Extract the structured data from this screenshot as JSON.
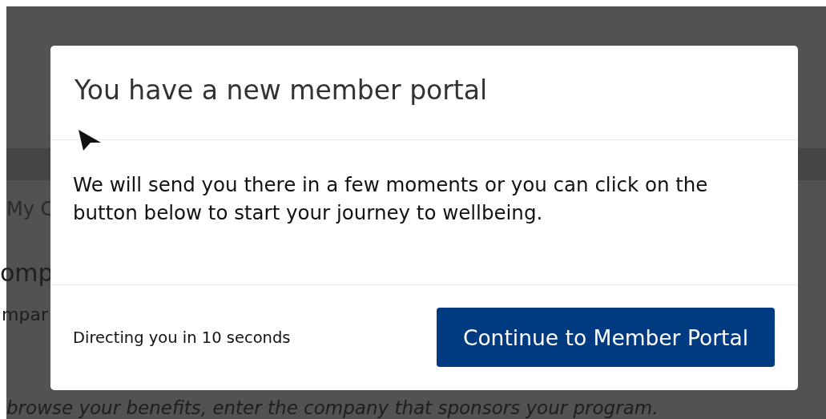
{
  "background": {
    "breadcrumb": "My C",
    "heading": "omp",
    "subheading": "mpar",
    "instruction": "browse your benefits, enter the company that sponsors your program."
  },
  "dialog": {
    "title": "You have a new member portal",
    "message": "We will send you there in a few moments or you can click on the button below to start your journey to wellbeing.",
    "countdown": "Directing you in 10 seconds",
    "button": "Continue to Member Portal"
  }
}
